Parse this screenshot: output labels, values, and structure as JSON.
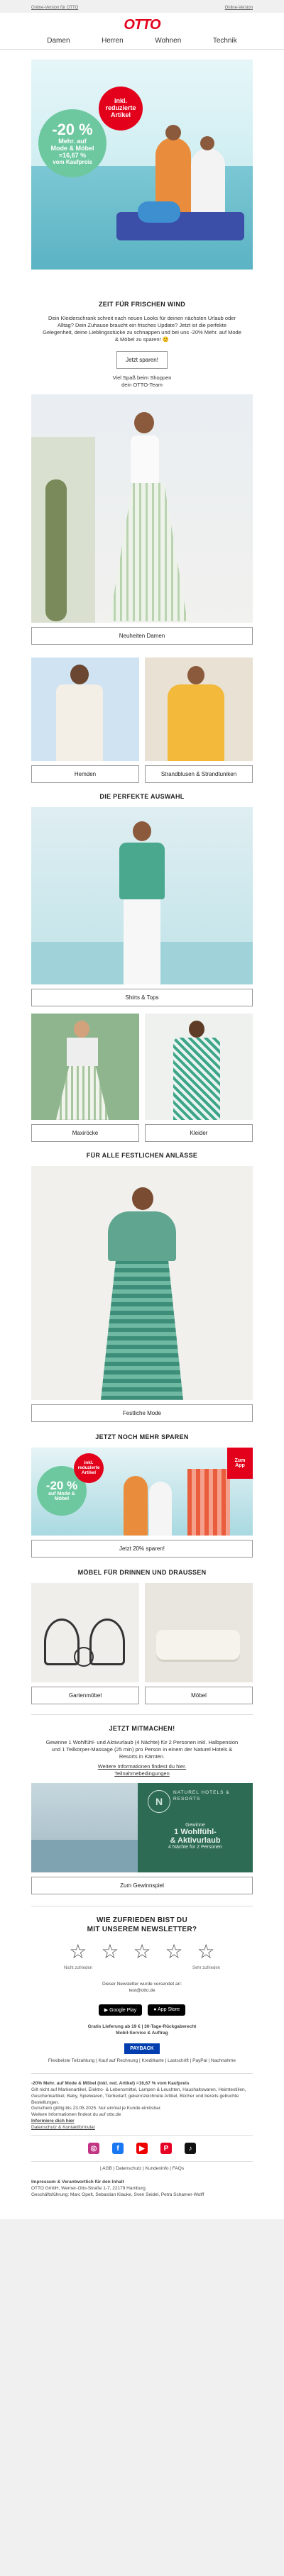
{
  "preheader": {
    "left": "Online-Version für OTTO",
    "right": "Online-Version"
  },
  "brand": {
    "logo": "OTTO",
    "accent": "#e3001b",
    "green": "#6dc8a0"
  },
  "nav": [
    "Damen",
    "Herren",
    "Wohnen",
    "Technik"
  ],
  "hero": {
    "badge_top": "inkl.",
    "badge_mid": "reduzierte",
    "badge_bot": "Artikel",
    "pct": "-20 %",
    "line1": "Mehr. auf",
    "line2": "Mode & Möbel",
    "line3": "=16,67 %",
    "line4": "vom Kaufpreis"
  },
  "intro": {
    "title": "ZEIT FÜR FRISCHEN WIND",
    "body": "Dein Kleiderschrank schreit nach neuen Looks für deinen nächsten Urlaub oder Alltag? Dein Zuhause braucht ein frisches Update? Jetzt ist die perfekte Gelegenheit, deine Lieblingsstücke zu schnappen und bei uns -20% Mehr. auf Mode & Möbel zu sparen! 😊",
    "button": "Jetzt sparen!",
    "sign1": "Viel Spaß beim Shoppen",
    "sign2": "dein OTTO-Team"
  },
  "women": {
    "button": "Neuheiten Damen"
  },
  "men": {
    "left": "Hemden",
    "right": "Strandblusen & Strandtuniken"
  },
  "perfect": {
    "title": "DIE PERFEKTE AUSWAHL",
    "button": "Shirts & Tops",
    "left": "Maxiröcke",
    "right": "Kleider"
  },
  "festive": {
    "title": "FÜR ALLE FESTLICHEN ANLÄSSE",
    "button": "Festliche Mode"
  },
  "save": {
    "title": "JETZT NOCH MEHR SPAREN",
    "button": "Jetzt 20% sparen!",
    "pct": "-20 %",
    "sub1": "auf Mode &",
    "sub2": "Möbel",
    "app1": "App",
    "app2": "Zum"
  },
  "furniture": {
    "title": "MÖBEL FÜR DRINNEN UND DRAUSSEN",
    "left": "Gartenmöbel",
    "right": "Möbel"
  },
  "contest": {
    "title": "JETZT MITMACHEN!",
    "body": "Gewinne 1 Wohlfühl- und Aktivurlaub (4 Nächte) für 2 Personen inkl. Halbpension und 1 Teilkörper-Massage (25 min) pro Person in einem der Naturel Hotels & Resorts in Kärnten.",
    "link": "Weitere Informationen findest du hier.",
    "terms": "Teilnahmebedingungen",
    "hotel": "NATUREL HOTELS & RESORTS",
    "prize_small": "Gewinne",
    "prize_big1": "1 Wohlfühl-",
    "prize_big2": "& Aktivurlaub",
    "prize_small2": "4 Nächte für 2 Personen",
    "button": "Zum Gewinnspiel"
  },
  "survey": {
    "title1": "WIE ZUFRIEDEN BIST DU",
    "title2": "MIT UNSEREM NEWSLETTER?",
    "note_left": "Nicht zufrieden",
    "note_right": "Sehr zufrieden",
    "legal1": "Dieser Newsletter wurde versendet an:",
    "legal2": "test@otto.de"
  },
  "apps": {
    "google": "Google Play",
    "apple": "App Store"
  },
  "service": {
    "line1": "Gratis Lieferung ab 19 € | 30-Tage-Rückgaberecht",
    "line2": "Mobil-Service & Auftrag",
    "paybadge": "PAYBACK",
    "methods": "Flexibelste Teilzahlung | Kauf auf Rechnung | Kreditkarte | Lastschrift | PayPal | Nachnahme"
  },
  "fineprint": {
    "p1": "-20% Mehr. auf Mode & Möbel (inkl. red. Artikel) =16,67 % vom Kaufpreis",
    "p2": "Gilt nicht auf Markenartikel, Elektro- & Lebensmittel, Lampen & Leuchten, Haushaltswaren, Heimtextilien, Geschenkartikel, Baby, Spielwaren, Tierbedarf, gekennzeichnete Artikel, Bücher und bereits gebuchte Bestellungen.",
    "p3": "Gutschein gültig bis 23.05.2025. Nur einmal je Kunde einlösbar.",
    "p4": "Weitere Informationen findest du auf otto.de",
    "p5": "Informiere dich hier",
    "p6": "Datenschutz & Kontaktformular"
  },
  "social": [
    {
      "icon": "instagram-icon",
      "color": "#c13584",
      "glyph": "◎"
    },
    {
      "icon": "facebook-icon",
      "color": "#1877f2",
      "glyph": "f"
    },
    {
      "icon": "youtube-icon",
      "color": "#e00",
      "glyph": "▶"
    },
    {
      "icon": "pinterest-icon",
      "color": "#e60023",
      "glyph": "P"
    },
    {
      "icon": "tiktok-icon",
      "color": "#111",
      "glyph": "♪"
    }
  ],
  "footer": {
    "links": "| AGB | Datenschutz | Kundeninfo | FAQs",
    "imprint1": "Impressum & Verantwortlich für den Inhalt",
    "imprint2": "OTTO GmbH, Werner-Otto-Straße 1-7, 22179 Hamburg",
    "imprint3": "Geschäftsführung: Marc Opelt, Sebastian Klauke, Sven Seidel, Petra Scharner-Wolff"
  }
}
